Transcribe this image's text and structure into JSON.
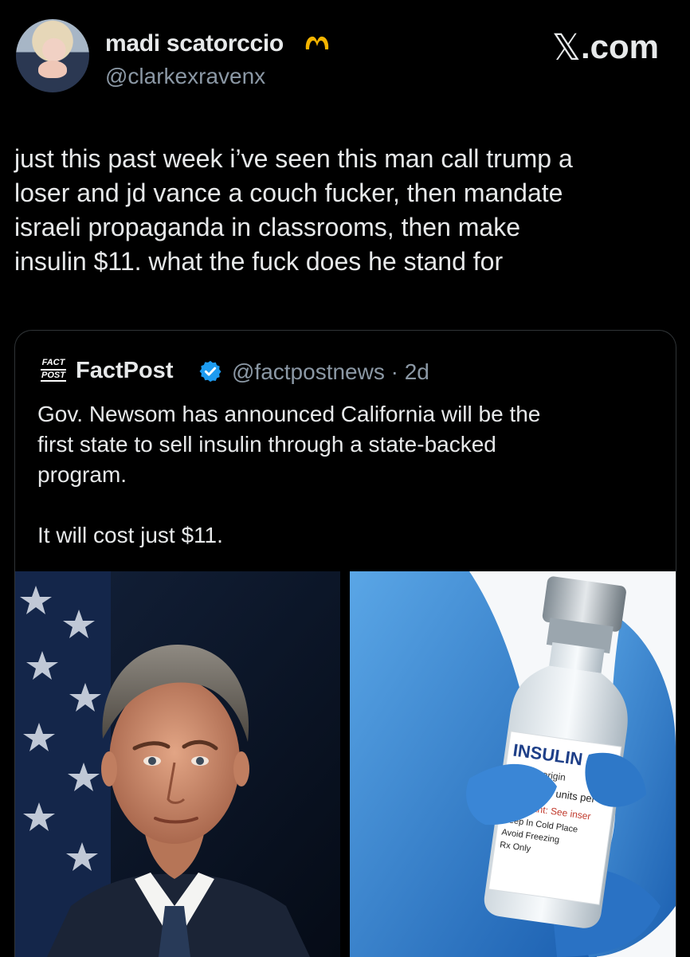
{
  "author": {
    "name": "madi scatorccio",
    "handle": "@clarkexravenx",
    "badge_icon": "heart-hands-icon"
  },
  "site": {
    "x_glyph": "𝕏",
    "label": ".com"
  },
  "tweet": {
    "lines": [
      "just this past week i’ve seen this man call trump a",
      "loser and jd vance a couch fucker, then mandate",
      "israeli propaganda in classrooms, then make",
      "insulin $11. what the fuck does he stand for"
    ]
  },
  "quote": {
    "logo_line1": "FACT",
    "logo_line2": "POST",
    "name": "FactPost",
    "verified_icon": "verified-badge-icon",
    "handle_time": "@factpostnews · 2d",
    "paragraph1": [
      "Gov. Newsom has announced California will be the",
      "first state to sell insulin through a state-backed",
      "program."
    ],
    "paragraph2": "It will cost just $11.",
    "vial_label": {
      "title": "INSULIN",
      "line1": "(rDNA) origin",
      "line2": "10 ml/100 units per",
      "line3": "Important: See inser",
      "line4": "Keep In Cold Place",
      "line5": "Avoid Freezing",
      "line6": "Rx Only"
    }
  },
  "colors": {
    "background": "#000000",
    "text": "#e7e9ea",
    "muted": "#8b98a5",
    "border": "#2f3336",
    "verified": "#1d9bf0",
    "badge_gold": "#f4b400"
  }
}
